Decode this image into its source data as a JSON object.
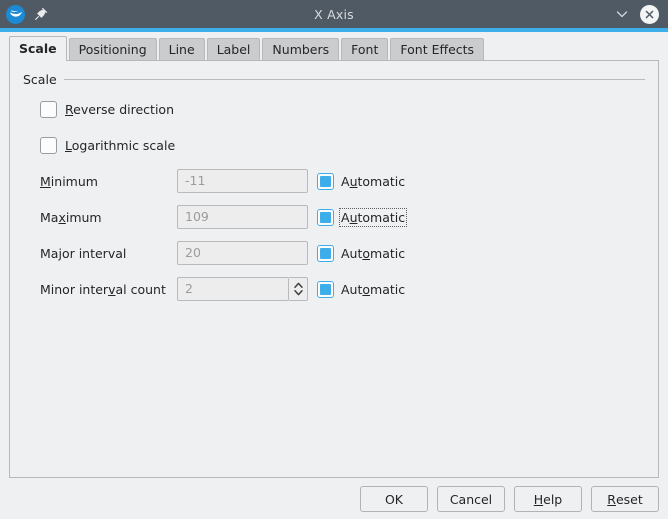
{
  "window": {
    "title": "X Axis",
    "app_icon": "libreoffice-calc-icon",
    "pin_icon": "pin-icon",
    "collapse_icon": "chevron-down-icon",
    "close_icon": "close-icon",
    "accent_color": "#3daee9",
    "titlebar_color": "#4f5a64"
  },
  "tabs": [
    {
      "label": "Scale",
      "active": true
    },
    {
      "label": "Positioning",
      "active": false
    },
    {
      "label": "Line",
      "active": false
    },
    {
      "label": "Label",
      "active": false
    },
    {
      "label": "Numbers",
      "active": false
    },
    {
      "label": "Font",
      "active": false
    },
    {
      "label": "Font Effects",
      "active": false
    }
  ],
  "scale_group": {
    "title": "Scale",
    "checkboxes": [
      {
        "label_pre": "",
        "label_accel": "R",
        "label_post": "everse direction",
        "checked": false
      },
      {
        "label_pre": "",
        "label_accel": "L",
        "label_post": "ogarithmic scale",
        "checked": false
      }
    ],
    "fields": [
      {
        "label_pre": "",
        "label_accel": "M",
        "label_post": "inimum",
        "value": "-11",
        "spinner": false,
        "auto": {
          "label_pre": "A",
          "label_accel": "u",
          "label_post": "tomatic",
          "checked": true,
          "focused": false
        }
      },
      {
        "label_pre": "Ma",
        "label_accel": "x",
        "label_post": "imum",
        "value": "109",
        "spinner": false,
        "auto": {
          "label_pre": "A",
          "label_accel": "u",
          "label_post": "tomatic",
          "checked": true,
          "focused": true
        }
      },
      {
        "label_pre": "Ma",
        "label_accel": "j",
        "label_post": "or interval",
        "value": "20",
        "spinner": false,
        "auto": {
          "label_pre": "Aut",
          "label_accel": "o",
          "label_post": "matic",
          "checked": true,
          "focused": false
        }
      },
      {
        "label_pre": "Minor inter",
        "label_accel": "v",
        "label_post": "al count",
        "value": "2",
        "spinner": true,
        "spin_up_icon": "chevron-up-icon",
        "spin_down_icon": "chevron-down-icon",
        "auto": {
          "label_pre": "Aut",
          "label_accel": "o",
          "label_post": "matic",
          "checked": true,
          "focused": false
        }
      }
    ]
  },
  "buttons": [
    {
      "label_pre": "OK",
      "label_accel": "",
      "label_post": ""
    },
    {
      "label_pre": "Cancel",
      "label_accel": "",
      "label_post": ""
    },
    {
      "label_pre": "",
      "label_accel": "H",
      "label_post": "elp"
    },
    {
      "label_pre": "",
      "label_accel": "R",
      "label_post": "eset"
    }
  ]
}
